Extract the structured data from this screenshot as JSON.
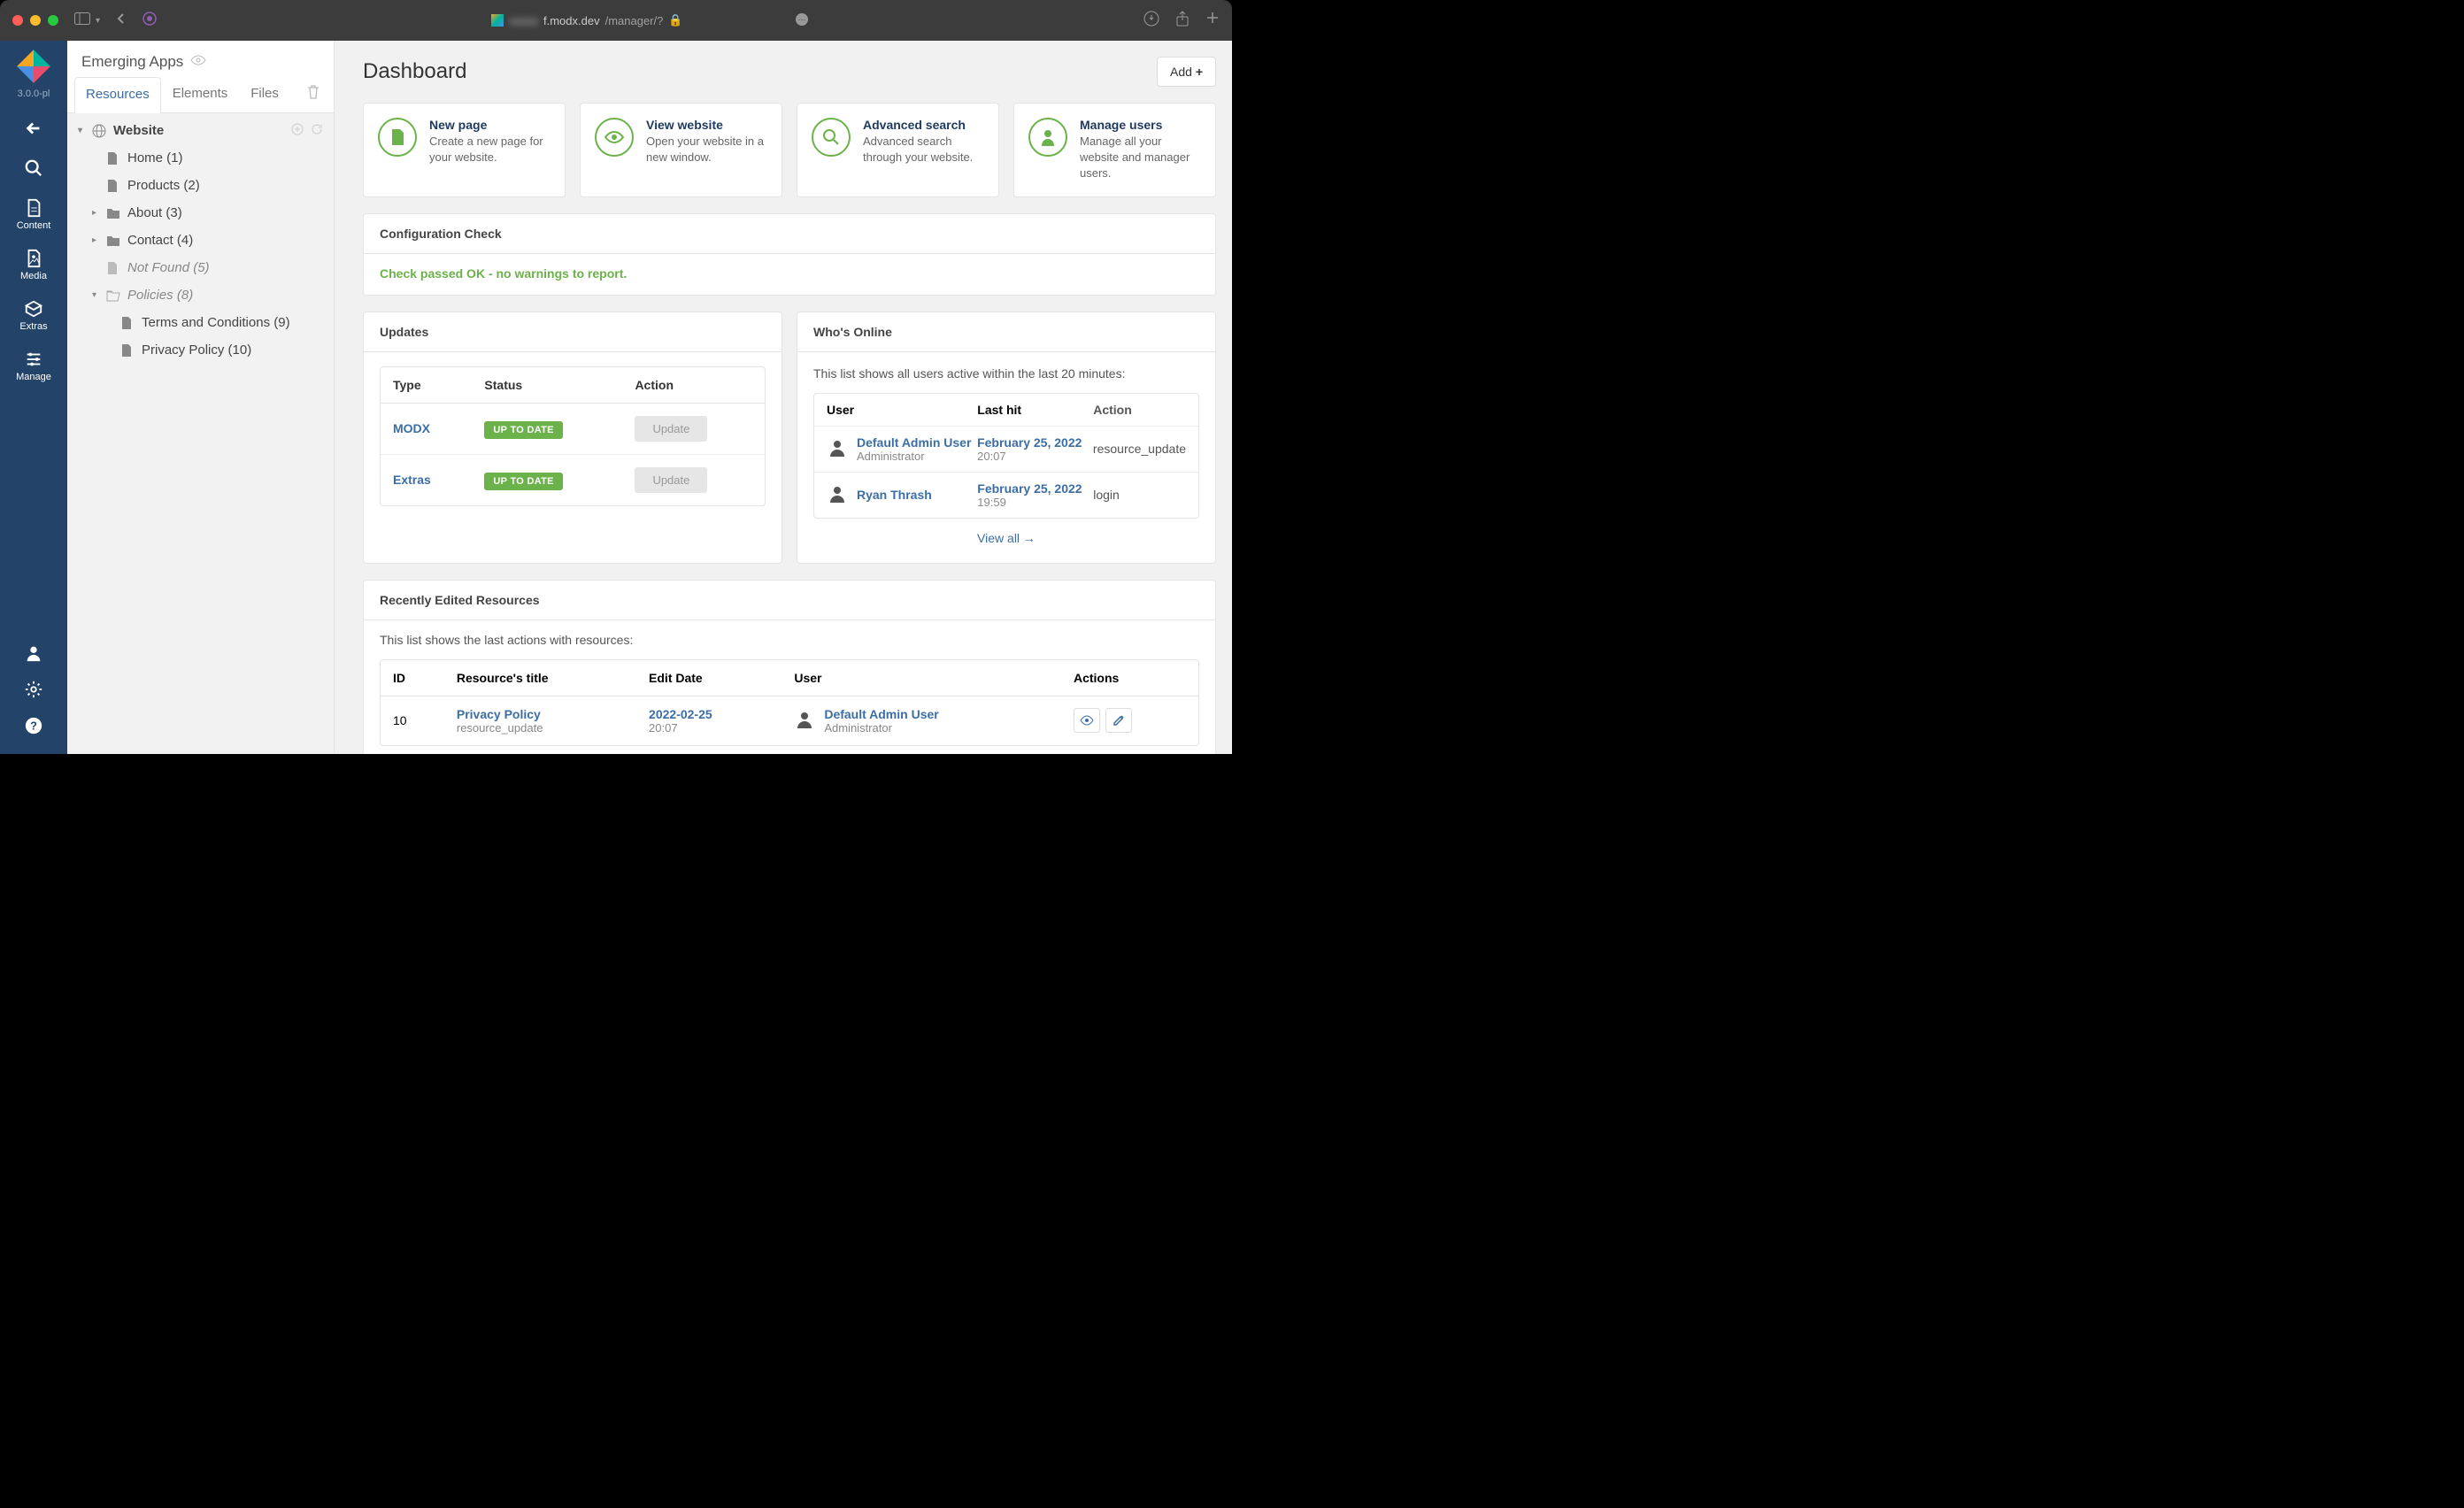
{
  "browser": {
    "url_host": "f.modx.dev",
    "url_path": "/manager/?",
    "hidden_prefix": "xxxxx"
  },
  "sidebar": {
    "version": "3.0.0-pl",
    "items": [
      {
        "label": "",
        "icon": "back"
      },
      {
        "label": "",
        "icon": "search"
      },
      {
        "label": "Content",
        "icon": "content"
      },
      {
        "label": "Media",
        "icon": "media"
      },
      {
        "label": "Extras",
        "icon": "extras"
      },
      {
        "label": "Manage",
        "icon": "manage"
      }
    ]
  },
  "tree": {
    "title": "Emerging Apps",
    "tabs": [
      {
        "label": "Resources",
        "active": true
      },
      {
        "label": "Elements",
        "active": false
      },
      {
        "label": "Files",
        "active": false
      }
    ],
    "root": "Website",
    "items": [
      {
        "label": "Home (1)",
        "type": "page",
        "indent": 1
      },
      {
        "label": "Products (2)",
        "type": "page",
        "indent": 1
      },
      {
        "label": "About (3)",
        "type": "folder",
        "indent": 1,
        "expandable": true
      },
      {
        "label": "Contact (4)",
        "type": "folder",
        "indent": 1,
        "expandable": true
      },
      {
        "label": "Not Found (5)",
        "type": "page",
        "indent": 1,
        "italic": true
      },
      {
        "label": "Policies (8)",
        "type": "folder-open",
        "indent": 1,
        "italic": true,
        "expanded": true
      },
      {
        "label": "Terms and Conditions (9)",
        "type": "page",
        "indent": 2
      },
      {
        "label": "Privacy Policy (10)",
        "type": "page",
        "indent": 2
      }
    ]
  },
  "main": {
    "title": "Dashboard",
    "add_label": "Add",
    "cards": [
      {
        "title": "New page",
        "desc": "Create a new page for your website.",
        "icon": "file"
      },
      {
        "title": "View website",
        "desc": "Open your website in a new window.",
        "icon": "eye"
      },
      {
        "title": "Advanced search",
        "desc": "Advanced search through your website.",
        "icon": "search"
      },
      {
        "title": "Manage users",
        "desc": "Manage all your website and manager users.",
        "icon": "user"
      }
    ],
    "config_check": {
      "title": "Configuration Check",
      "message": "Check passed OK - no warnings to report."
    },
    "updates": {
      "title": "Updates",
      "headers": {
        "type": "Type",
        "status": "Status",
        "action": "Action"
      },
      "rows": [
        {
          "type": "MODX",
          "status": "UP TO DATE",
          "action": "Update"
        },
        {
          "type": "Extras",
          "status": "UP TO DATE",
          "action": "Update"
        }
      ]
    },
    "whos_online": {
      "title": "Who's Online",
      "desc": "This list shows all users active within the last 20 minutes:",
      "headers": {
        "user": "User",
        "last_hit": "Last hit",
        "action": "Action"
      },
      "rows": [
        {
          "name": "Default Admin User",
          "role": "Administrator",
          "date": "February 25, 2022",
          "time": "20:07",
          "action": "resource_update"
        },
        {
          "name": "Ryan Thrash",
          "role": "",
          "date": "February 25, 2022",
          "time": "19:59",
          "action": "login"
        }
      ],
      "view_all": "View all →"
    },
    "recent": {
      "title": "Recently Edited Resources",
      "desc": "This list shows the last actions with resources:",
      "headers": {
        "id": "ID",
        "title": "Resource's title",
        "edit_date": "Edit Date",
        "user": "User",
        "actions": "Actions"
      },
      "rows": [
        {
          "id": "10",
          "title": "Privacy Policy",
          "sub": "resource_update",
          "date": "2022-02-25",
          "time": "20:07",
          "user": "Default Admin User",
          "role": "Administrator"
        }
      ]
    }
  }
}
